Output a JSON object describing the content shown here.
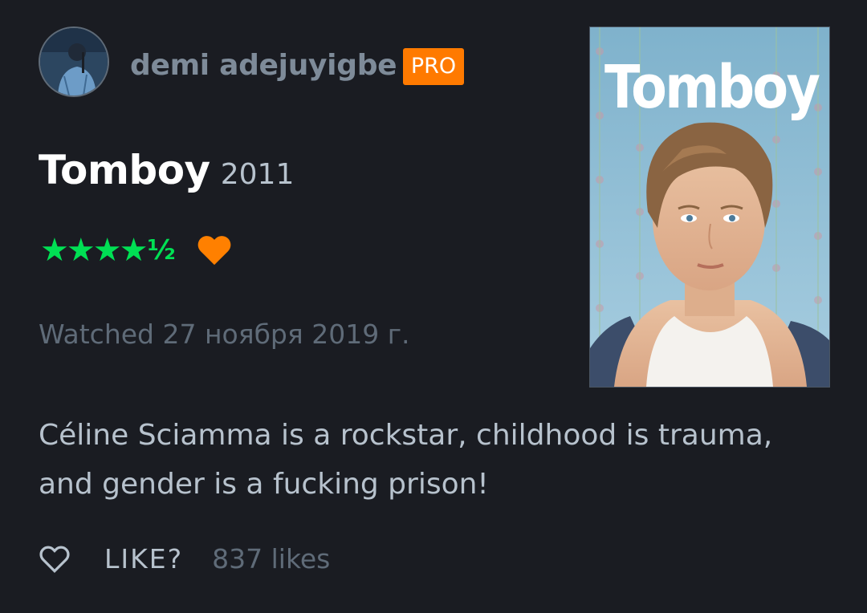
{
  "reviewer": {
    "name": "demi adejuyigbe",
    "badge": "PRO"
  },
  "film": {
    "title": "Tomboy",
    "year": "2011",
    "poster_title": "Tomboy"
  },
  "rating": {
    "stars": 4.5,
    "stars_text": "★★★★",
    "half_text": "½",
    "liked": true
  },
  "watched_text": "Watched 27 ноября 2019 г.",
  "review_text": "Céline Sciamma is a rockstar, childhood is trauma, and gender is a fucking prison!",
  "footer": {
    "like_label": "LIKE?",
    "likes_count": "837 likes"
  },
  "colors": {
    "background": "#1a1c22",
    "star_green": "#00e054",
    "accent_orange": "#ff7a00",
    "muted_text": "#5f6b78",
    "body_text": "#b7c2cd"
  },
  "icons": {
    "liked": "heart-filled-icon",
    "like_action": "heart-outline-icon"
  }
}
